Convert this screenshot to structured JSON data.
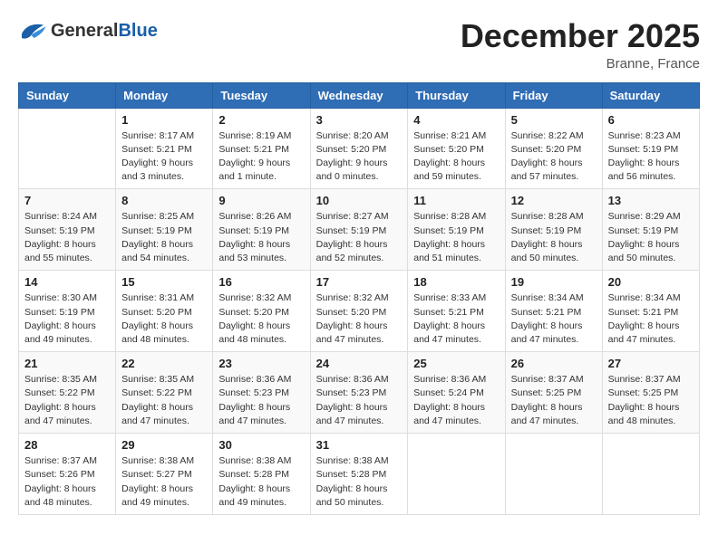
{
  "logo": {
    "general": "General",
    "blue": "Blue",
    "tagline": "GeneralBlue"
  },
  "header": {
    "month_year": "December 2025",
    "location": "Branne, France"
  },
  "weekdays": [
    "Sunday",
    "Monday",
    "Tuesday",
    "Wednesday",
    "Thursday",
    "Friday",
    "Saturday"
  ],
  "weeks": [
    [
      {
        "day": "",
        "sunrise": "",
        "sunset": "",
        "daylight": ""
      },
      {
        "day": "1",
        "sunrise": "Sunrise: 8:17 AM",
        "sunset": "Sunset: 5:21 PM",
        "daylight": "Daylight: 9 hours and 3 minutes."
      },
      {
        "day": "2",
        "sunrise": "Sunrise: 8:19 AM",
        "sunset": "Sunset: 5:21 PM",
        "daylight": "Daylight: 9 hours and 1 minute."
      },
      {
        "day": "3",
        "sunrise": "Sunrise: 8:20 AM",
        "sunset": "Sunset: 5:20 PM",
        "daylight": "Daylight: 9 hours and 0 minutes."
      },
      {
        "day": "4",
        "sunrise": "Sunrise: 8:21 AM",
        "sunset": "Sunset: 5:20 PM",
        "daylight": "Daylight: 8 hours and 59 minutes."
      },
      {
        "day": "5",
        "sunrise": "Sunrise: 8:22 AM",
        "sunset": "Sunset: 5:20 PM",
        "daylight": "Daylight: 8 hours and 57 minutes."
      },
      {
        "day": "6",
        "sunrise": "Sunrise: 8:23 AM",
        "sunset": "Sunset: 5:19 PM",
        "daylight": "Daylight: 8 hours and 56 minutes."
      }
    ],
    [
      {
        "day": "7",
        "sunrise": "Sunrise: 8:24 AM",
        "sunset": "Sunset: 5:19 PM",
        "daylight": "Daylight: 8 hours and 55 minutes."
      },
      {
        "day": "8",
        "sunrise": "Sunrise: 8:25 AM",
        "sunset": "Sunset: 5:19 PM",
        "daylight": "Daylight: 8 hours and 54 minutes."
      },
      {
        "day": "9",
        "sunrise": "Sunrise: 8:26 AM",
        "sunset": "Sunset: 5:19 PM",
        "daylight": "Daylight: 8 hours and 53 minutes."
      },
      {
        "day": "10",
        "sunrise": "Sunrise: 8:27 AM",
        "sunset": "Sunset: 5:19 PM",
        "daylight": "Daylight: 8 hours and 52 minutes."
      },
      {
        "day": "11",
        "sunrise": "Sunrise: 8:28 AM",
        "sunset": "Sunset: 5:19 PM",
        "daylight": "Daylight: 8 hours and 51 minutes."
      },
      {
        "day": "12",
        "sunrise": "Sunrise: 8:28 AM",
        "sunset": "Sunset: 5:19 PM",
        "daylight": "Daylight: 8 hours and 50 minutes."
      },
      {
        "day": "13",
        "sunrise": "Sunrise: 8:29 AM",
        "sunset": "Sunset: 5:19 PM",
        "daylight": "Daylight: 8 hours and 50 minutes."
      }
    ],
    [
      {
        "day": "14",
        "sunrise": "Sunrise: 8:30 AM",
        "sunset": "Sunset: 5:19 PM",
        "daylight": "Daylight: 8 hours and 49 minutes."
      },
      {
        "day": "15",
        "sunrise": "Sunrise: 8:31 AM",
        "sunset": "Sunset: 5:20 PM",
        "daylight": "Daylight: 8 hours and 48 minutes."
      },
      {
        "day": "16",
        "sunrise": "Sunrise: 8:32 AM",
        "sunset": "Sunset: 5:20 PM",
        "daylight": "Daylight: 8 hours and 48 minutes."
      },
      {
        "day": "17",
        "sunrise": "Sunrise: 8:32 AM",
        "sunset": "Sunset: 5:20 PM",
        "daylight": "Daylight: 8 hours and 47 minutes."
      },
      {
        "day": "18",
        "sunrise": "Sunrise: 8:33 AM",
        "sunset": "Sunset: 5:21 PM",
        "daylight": "Daylight: 8 hours and 47 minutes."
      },
      {
        "day": "19",
        "sunrise": "Sunrise: 8:34 AM",
        "sunset": "Sunset: 5:21 PM",
        "daylight": "Daylight: 8 hours and 47 minutes."
      },
      {
        "day": "20",
        "sunrise": "Sunrise: 8:34 AM",
        "sunset": "Sunset: 5:21 PM",
        "daylight": "Daylight: 8 hours and 47 minutes."
      }
    ],
    [
      {
        "day": "21",
        "sunrise": "Sunrise: 8:35 AM",
        "sunset": "Sunset: 5:22 PM",
        "daylight": "Daylight: 8 hours and 47 minutes."
      },
      {
        "day": "22",
        "sunrise": "Sunrise: 8:35 AM",
        "sunset": "Sunset: 5:22 PM",
        "daylight": "Daylight: 8 hours and 47 minutes."
      },
      {
        "day": "23",
        "sunrise": "Sunrise: 8:36 AM",
        "sunset": "Sunset: 5:23 PM",
        "daylight": "Daylight: 8 hours and 47 minutes."
      },
      {
        "day": "24",
        "sunrise": "Sunrise: 8:36 AM",
        "sunset": "Sunset: 5:23 PM",
        "daylight": "Daylight: 8 hours and 47 minutes."
      },
      {
        "day": "25",
        "sunrise": "Sunrise: 8:36 AM",
        "sunset": "Sunset: 5:24 PM",
        "daylight": "Daylight: 8 hours and 47 minutes."
      },
      {
        "day": "26",
        "sunrise": "Sunrise: 8:37 AM",
        "sunset": "Sunset: 5:25 PM",
        "daylight": "Daylight: 8 hours and 47 minutes."
      },
      {
        "day": "27",
        "sunrise": "Sunrise: 8:37 AM",
        "sunset": "Sunset: 5:25 PM",
        "daylight": "Daylight: 8 hours and 48 minutes."
      }
    ],
    [
      {
        "day": "28",
        "sunrise": "Sunrise: 8:37 AM",
        "sunset": "Sunset: 5:26 PM",
        "daylight": "Daylight: 8 hours and 48 minutes."
      },
      {
        "day": "29",
        "sunrise": "Sunrise: 8:38 AM",
        "sunset": "Sunset: 5:27 PM",
        "daylight": "Daylight: 8 hours and 49 minutes."
      },
      {
        "day": "30",
        "sunrise": "Sunrise: 8:38 AM",
        "sunset": "Sunset: 5:28 PM",
        "daylight": "Daylight: 8 hours and 49 minutes."
      },
      {
        "day": "31",
        "sunrise": "Sunrise: 8:38 AM",
        "sunset": "Sunset: 5:28 PM",
        "daylight": "Daylight: 8 hours and 50 minutes."
      },
      {
        "day": "",
        "sunrise": "",
        "sunset": "",
        "daylight": ""
      },
      {
        "day": "",
        "sunrise": "",
        "sunset": "",
        "daylight": ""
      },
      {
        "day": "",
        "sunrise": "",
        "sunset": "",
        "daylight": ""
      }
    ]
  ]
}
